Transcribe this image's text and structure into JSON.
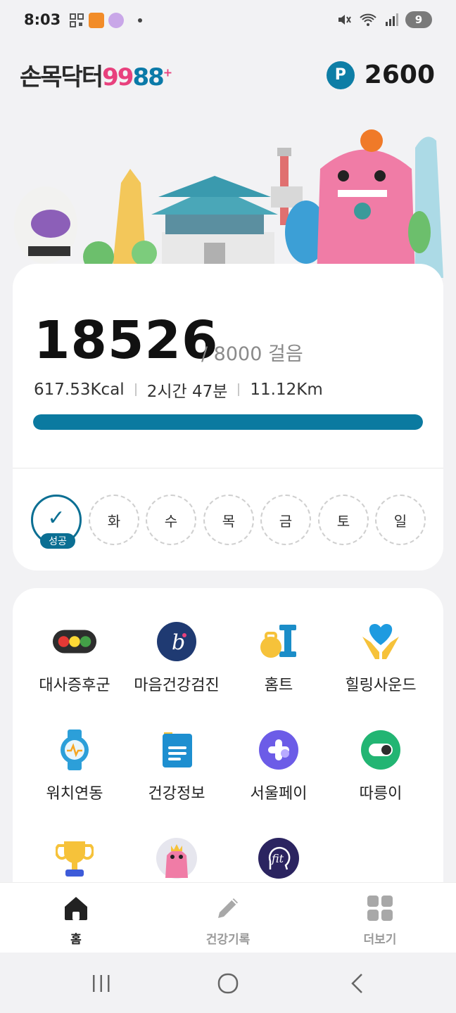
{
  "status_bar": {
    "time": "8:03",
    "battery": "9"
  },
  "header": {
    "logo_text": "손목닥터",
    "logo_num_a": "99",
    "logo_num_b": "88",
    "logo_plus": "+",
    "points_badge": "P",
    "points_value": "2600"
  },
  "steps": {
    "count": "18526",
    "goal_text": "/ 8000 걸음",
    "calories": "617.53Kcal",
    "duration": "2시간 47분",
    "distance": "11.12Km",
    "progress_fraction": 1.0
  },
  "week": {
    "days": [
      {
        "label": "",
        "done": true,
        "badge": "성공"
      },
      {
        "label": "화",
        "done": false
      },
      {
        "label": "수",
        "done": false
      },
      {
        "label": "목",
        "done": false
      },
      {
        "label": "금",
        "done": false
      },
      {
        "label": "토",
        "done": false
      },
      {
        "label": "일",
        "done": false
      }
    ]
  },
  "menu": {
    "items": [
      {
        "label": "대사증후군",
        "icon": "traffic-light-icon"
      },
      {
        "label": "마음건강검진",
        "icon": "mind-b-icon"
      },
      {
        "label": "홈트",
        "icon": "kettlebell-dumbbell-icon"
      },
      {
        "label": "힐링사운드",
        "icon": "heart-hands-icon"
      },
      {
        "label": "워치연동",
        "icon": "watch-icon"
      },
      {
        "label": "건강정보",
        "icon": "document-icon"
      },
      {
        "label": "서울페이",
        "icon": "seoul-pay-icon"
      },
      {
        "label": "따릉이",
        "icon": "bike-toggle-icon"
      },
      {
        "label": "",
        "icon": "trophy-icon"
      },
      {
        "label": "",
        "icon": "character-avatar-icon"
      },
      {
        "label": "",
        "icon": "fit-head-icon"
      }
    ]
  },
  "bottom_nav": {
    "items": [
      {
        "label": "홈",
        "icon": "home-icon",
        "active": true
      },
      {
        "label": "건강기록",
        "icon": "pencil-icon",
        "active": false
      },
      {
        "label": "더보기",
        "icon": "grid-icon",
        "active": false
      }
    ]
  },
  "colors": {
    "brand": "#0b7aa0",
    "accent_pink": "#e8417d",
    "background": "#f2f2f4"
  }
}
